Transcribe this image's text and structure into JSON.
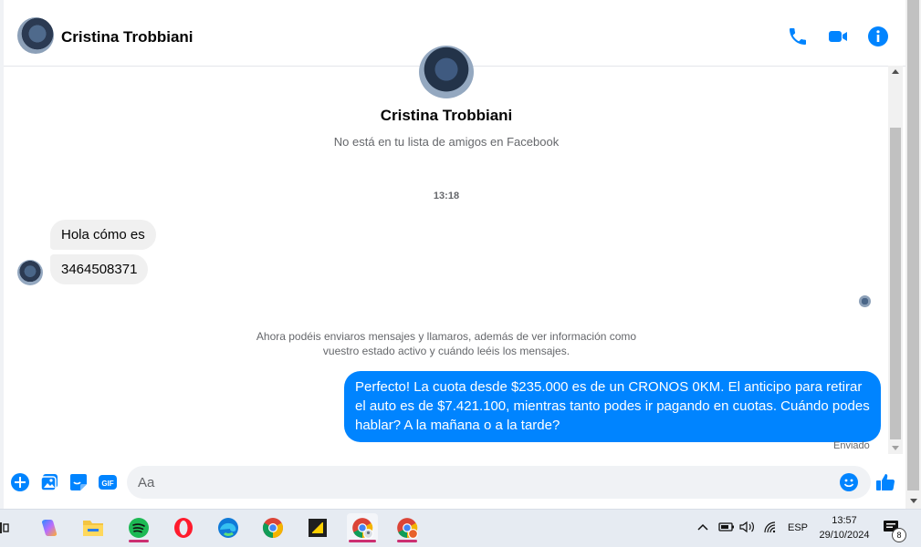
{
  "header": {
    "contact_name": "Cristina Trobbiani"
  },
  "profile": {
    "name": "Cristina Trobbiani",
    "subtitle": "No está en tu lista de amigos en Facebook"
  },
  "thread": {
    "time_separator": "13:18",
    "incoming": [
      {
        "text": "Hola cómo es"
      },
      {
        "text": "3464508371"
      }
    ],
    "notice": "Ahora podéis enviaros mensajes y llamaros, además de ver información como vuestro estado activo y cuándo leéis los mensajes.",
    "outgoing": {
      "text": "Perfecto! La cuota desde $235.000 es de un CRONOS 0KM. El anticipo para retirar el auto es de $7.421.100, mientras tanto podes ir pagando en cuotas. Cuándo podes hablar? A la mañana o a la tarde?",
      "status": "Enviado"
    }
  },
  "composer": {
    "placeholder": "Aa"
  },
  "colors": {
    "accent": "#0084ff",
    "incoming_bubble": "#f0f0f0"
  },
  "taskbar": {
    "apps": [
      "copilot-icon",
      "file-explorer-icon",
      "spotify-icon",
      "opera-icon",
      "edge-icon",
      "chrome-icon",
      "sticky-notes-icon",
      "chrome-profile-icon",
      "chrome-profile-2-icon"
    ],
    "language": "ESP",
    "time": "13:57",
    "date": "29/10/2024",
    "notification_count": "8"
  }
}
